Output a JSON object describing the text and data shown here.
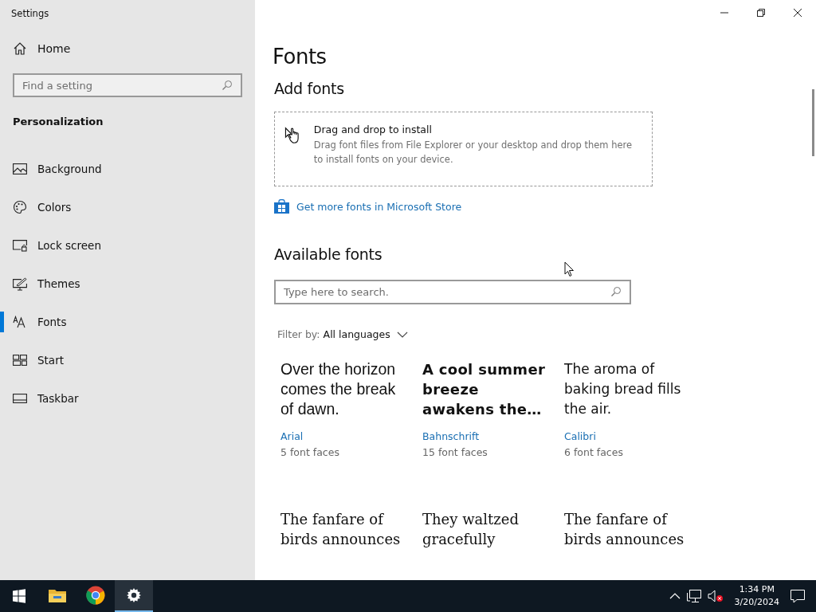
{
  "window": {
    "title": "Settings"
  },
  "sidebar": {
    "home": "Home",
    "search": {
      "placeholder": "Find a setting"
    },
    "section": "Personalization",
    "items": [
      {
        "label": "Background",
        "kind": "background",
        "selected": false
      },
      {
        "label": "Colors",
        "kind": "colors",
        "selected": false
      },
      {
        "label": "Lock screen",
        "kind": "lock",
        "selected": false
      },
      {
        "label": "Themes",
        "kind": "themes",
        "selected": false
      },
      {
        "label": "Fonts",
        "kind": "fonts",
        "selected": true
      },
      {
        "label": "Start",
        "kind": "start",
        "selected": false
      },
      {
        "label": "Taskbar",
        "kind": "taskbar",
        "selected": false
      }
    ]
  },
  "page": {
    "title": "Fonts",
    "add_heading": "Add fonts",
    "drop": {
      "title": "Drag and drop to install",
      "text": "Drag font files from File Explorer or your desktop and drop them here to install fonts on your device."
    },
    "store_link": "Get more fonts in Microsoft Store",
    "available_heading": "Available fonts",
    "search": {
      "placeholder": "Type here to search."
    },
    "filter": {
      "label": "Filter by:",
      "value": "All languages"
    },
    "fonts": [
      {
        "kind": "sans",
        "sample": "Over the horizon comes the break of dawn.",
        "name": "Arial",
        "faces": "5 font faces"
      },
      {
        "kind": "bold",
        "sample": "A cool summer breeze awakens the…",
        "name": "Bahnschrift",
        "faces": "15 font faces"
      },
      {
        "kind": "humanist",
        "sample": "The aroma of baking bread fills the air.",
        "name": "Calibri",
        "faces": "6 font faces"
      },
      {
        "kind": "serif",
        "sample": "The fanfare of birds announces"
      },
      {
        "kind": "serif",
        "sample": "They waltzed gracefully"
      },
      {
        "kind": "serif",
        "sample": "The fanfare of birds announces"
      }
    ]
  },
  "taskbar": {
    "time": "1:34 PM",
    "date": "3/20/2024",
    "apps": [
      {
        "kind": "explorer",
        "selected": false
      },
      {
        "kind": "chrome",
        "selected": false
      },
      {
        "kind": "settings",
        "selected": true
      }
    ]
  }
}
